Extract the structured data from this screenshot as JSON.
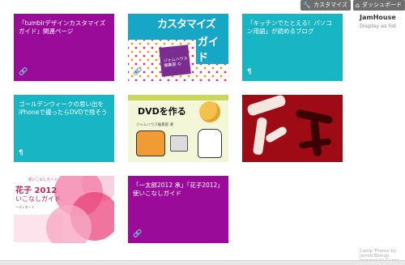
{
  "adminbar": {
    "customize_label": "カスタマイズ",
    "customize_icon": "wrench-icon",
    "dashboard_label": "ダッシュボード",
    "dashboard_icon": "home-icon"
  },
  "site": {
    "title": "JamHouse",
    "subtitle": "Display as list"
  },
  "posts": [
    {
      "title": "「tumblrデザインカスタマイズガイド」関連ページ",
      "type_icon": "link-icon",
      "color": "#9a0b9a"
    },
    {
      "title": "「キッチンでたとえる！パソコン用語」が読めるブログ",
      "type_icon": "paragraph-icon",
      "color": "#18b5c4"
    },
    {
      "title": "ゴールデンウィークの思い出をiPhoneで撮ったらDVDで残そう",
      "type_icon": "paragraph-icon",
      "color": "#18b5c4"
    },
    {
      "title": "「一太郎2012 承」「花子2012」使いこなしガイド",
      "type_icon": "link-icon",
      "color": "#9a0b9a"
    }
  ],
  "images": {
    "cover1": {
      "line1": "カスタマイズ",
      "line2": "ガイド",
      "badge": "ジャムハウス 編集部 ©"
    },
    "cover2": {
      "headline": "DVDを作る",
      "publisher": "ジャムハウス編集部 著"
    },
    "cover4": {
      "top": "使いこなしガイド",
      "title": "花子 2012",
      "subtitle": "いこなしガイド",
      "author": "ーディネート"
    }
  },
  "footer": {
    "text": "Camp Theme by Jarred Bishop. Inspired by Cargo."
  },
  "colors": {
    "purple": "#9a0b9a",
    "cyan": "#18b5c4"
  }
}
